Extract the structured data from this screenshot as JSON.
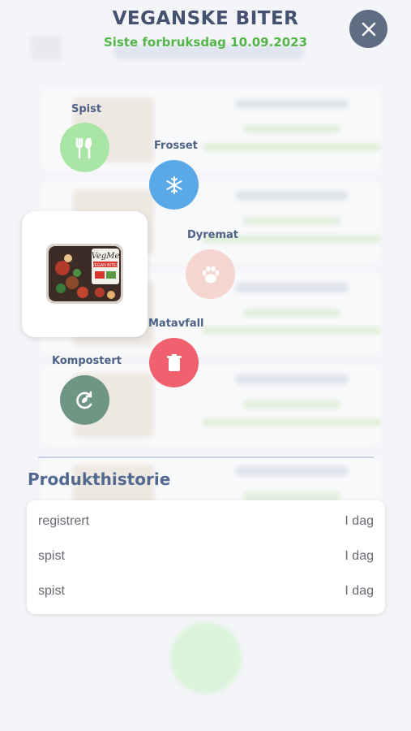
{
  "header": {
    "title": "VEGANSKE BITER",
    "subtitle": "Siste forbruksdag 10.09.2023"
  },
  "actions": [
    {
      "label": "Spist",
      "icon": "fork-knife-icon",
      "color": "#a9e6a5"
    },
    {
      "label": "Frosset",
      "icon": "snowflake-icon",
      "color": "#5aa9e6"
    },
    {
      "label": "Dyremat",
      "icon": "paw-icon",
      "color": "#f5d5cf"
    },
    {
      "label": "Matavfall",
      "icon": "trash-icon",
      "color": "#f0606e"
    },
    {
      "label": "Kompostert",
      "icon": "compost-icon",
      "color": "#6f9585"
    }
  ],
  "product": {
    "image_brand": "VegMe",
    "image_name": "VEGAN BITES"
  },
  "history": {
    "title": "Produkthistorie",
    "rows": [
      {
        "event": "registrert",
        "when": "I dag"
      },
      {
        "event": "spist",
        "when": "I dag"
      },
      {
        "event": "spist",
        "when": "I dag"
      }
    ]
  },
  "colors": {
    "title": "#44526f",
    "subtitle": "#55b54a",
    "close_button": "#5e6c84",
    "label": "#4e6285"
  }
}
